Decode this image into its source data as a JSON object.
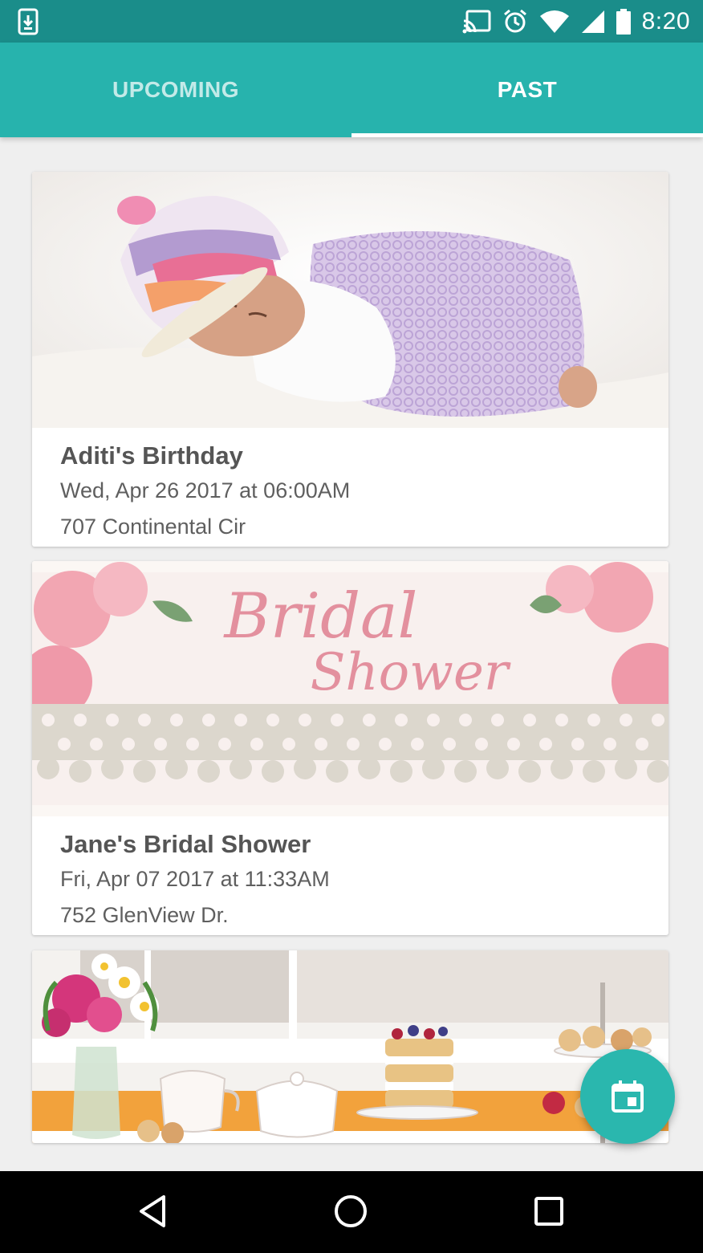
{
  "status_bar": {
    "time": "8:20",
    "icons": [
      "download-notification-icon",
      "cast-icon",
      "alarm-icon",
      "wifi-icon",
      "cellular-signal-icon",
      "battery-icon"
    ]
  },
  "tabs": [
    {
      "label": "UPCOMING",
      "selected": false
    },
    {
      "label": "PAST",
      "selected": true
    }
  ],
  "events": [
    {
      "title": "Aditi's Birthday",
      "date": "Wed, Apr 26 2017 at 06:00AM",
      "address": "707 Continental Cir",
      "image": "sleeping-baby-photo"
    },
    {
      "title": "Jane's Bridal Shower",
      "date": "Fri, Apr 07 2017 at 11:33AM",
      "address": "752 GlenView Dr.",
      "image": "bridal-shower-banner",
      "image_text_1": "Bridal",
      "image_text_2": "Shower"
    },
    {
      "title": "",
      "date": "",
      "address": "",
      "image": "tea-party-table-photo"
    }
  ],
  "fab": {
    "icon": "calendar-icon"
  },
  "nav_bar": {
    "icons": [
      "back-icon",
      "home-icon",
      "recents-icon"
    ]
  },
  "colors": {
    "status_bar": "#1a8d8a",
    "app_bar": "#27b3ad",
    "fab": "#2ab7ae",
    "background": "#efefef"
  }
}
